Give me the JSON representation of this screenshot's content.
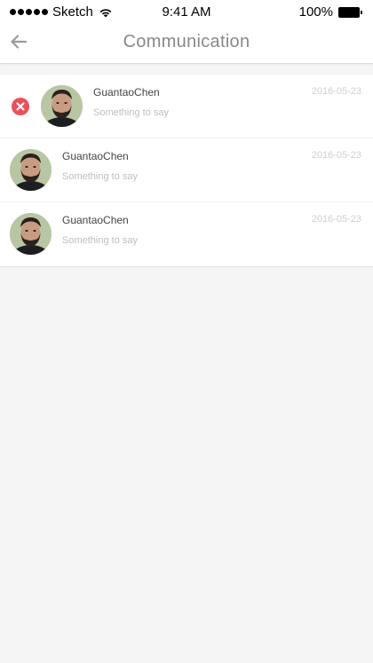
{
  "status_bar": {
    "carrier": "Sketch",
    "time": "9:41 AM",
    "battery": "100%"
  },
  "nav": {
    "title": "Communication",
    "back_icon": "arrow-left-icon"
  },
  "items": [
    {
      "name": "GuantaoChen",
      "message": "Something to say",
      "date": "2016-05-23",
      "editing": true
    },
    {
      "name": "GuantaoChen",
      "message": "Something to say",
      "date": "2016-05-23",
      "editing": false
    },
    {
      "name": "GuantaoChen",
      "message": "Something to say",
      "date": "2016-05-23",
      "editing": false
    }
  ],
  "colors": {
    "delete": "#e8505b",
    "background": "#f5f5f5",
    "title": "#888888"
  }
}
